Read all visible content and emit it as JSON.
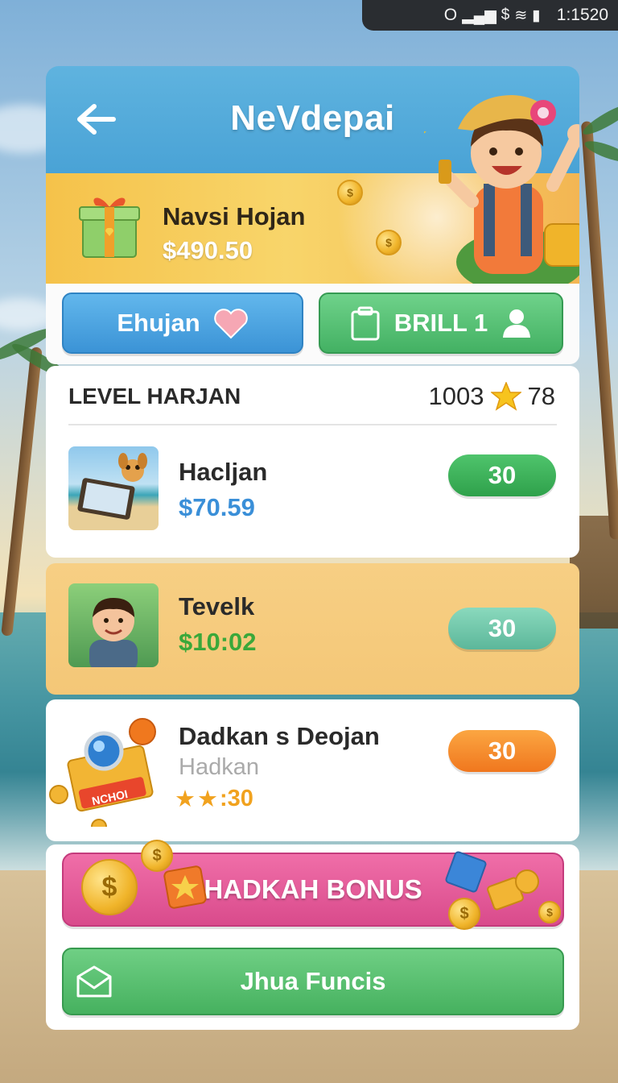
{
  "status_bar": {
    "indicator": "O",
    "time": "1:1520"
  },
  "header": {
    "title": "NeVdepai",
    "back_icon": "back-arrow-icon"
  },
  "banner": {
    "name": "Navsi Hojan",
    "amount": "$490.50",
    "gift_icon": "gift-box-icon",
    "mascot": "cheering-boy-mascot"
  },
  "actions": {
    "primary_label": "Ehujan",
    "primary_icon": "heart-icon",
    "secondary_label": "BRILL 1",
    "secondary_icon": "user-icon"
  },
  "level": {
    "title": "LEVEL HARJAN",
    "points": "1003",
    "stars": "78"
  },
  "rows": [
    {
      "name": "Hacljan",
      "amount": "$70.59",
      "button": "30",
      "amount_color": "#3a8fd8",
      "button_color": "#3fb35c"
    },
    {
      "name": "Tevelk",
      "amount": "$10:02",
      "button": "30",
      "amount_color": "#3aa83a",
      "button_color": "#6cc7a8"
    },
    {
      "name": "Dadkan s Deojan",
      "subtitle": "Hadkan",
      "stars_value": ":30",
      "button": "30",
      "button_color": "#f59a24",
      "badge_text": "NCHOI"
    }
  ],
  "bonus": {
    "label": "HADKAH BONUS"
  },
  "funcs": {
    "label": "Jhua Funcis"
  },
  "colors": {
    "header_blue": "#4aa3d6",
    "accent_green": "#46b15f",
    "accent_pink": "#d94b8c",
    "accent_orange": "#f59a24"
  }
}
